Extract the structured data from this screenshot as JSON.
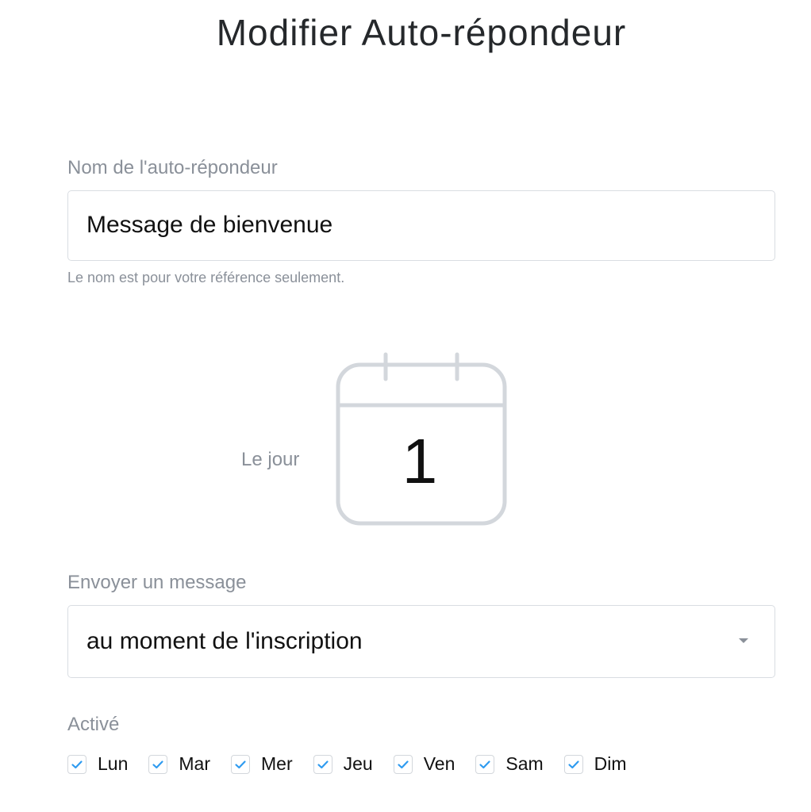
{
  "page": {
    "title": "Modifier Auto-répondeur"
  },
  "name_field": {
    "label": "Nom de l'auto-répondeur",
    "value": "Message de bienvenue",
    "helper": "Le nom est pour votre référence seulement."
  },
  "schedule": {
    "label": "Le jour",
    "day_number": "1",
    "icon": "calendar-icon"
  },
  "send_field": {
    "label": "Envoyer un message",
    "selected": "au moment de l'inscription",
    "icon": "chevron-down-icon"
  },
  "active": {
    "label": "Activé",
    "days": [
      {
        "label": "Lun",
        "checked": true
      },
      {
        "label": "Mar",
        "checked": true
      },
      {
        "label": "Mer",
        "checked": true
      },
      {
        "label": "Jeu",
        "checked": true
      },
      {
        "label": "Ven",
        "checked": true
      },
      {
        "label": "Sam",
        "checked": true
      },
      {
        "label": "Dim",
        "checked": true
      }
    ],
    "check_color": "#2f9bf0"
  }
}
